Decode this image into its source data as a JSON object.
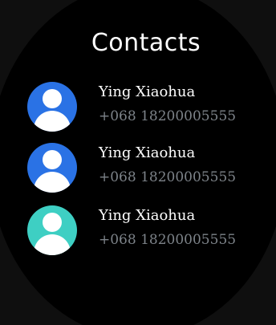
{
  "header": {
    "title": "Contacts"
  },
  "contacts": [
    {
      "name": "Ying Xiaohua",
      "phone": "+068  18200005555",
      "avatar_color": "#2a72e5"
    },
    {
      "name": "Ying Xiaohua",
      "phone": "+068  18200005555",
      "avatar_color": "#2a72e5"
    },
    {
      "name": "Ying Xiaohua",
      "phone": "+068  18200005555",
      "avatar_color": "#3ecfc3"
    }
  ],
  "colors": {
    "background": "#000000",
    "title": "#ffffff",
    "name": "#ffffff",
    "phone": "#7d8389"
  },
  "icons": {
    "avatar": "person-avatar-icon"
  }
}
